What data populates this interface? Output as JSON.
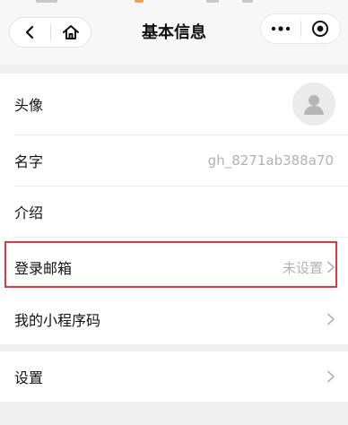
{
  "header": {
    "title": "基本信息",
    "back_icon": "chevron-left-icon",
    "home_icon": "home-icon",
    "more_icon": "more-dots-icon",
    "close_icon": "target-circle-icon"
  },
  "rows": {
    "avatar": {
      "label": "头像"
    },
    "name": {
      "label": "名字",
      "value": "gh_8271ab388a70"
    },
    "intro": {
      "label": "介绍"
    },
    "email": {
      "label": "登录邮箱",
      "value": "未设置"
    },
    "qrcode": {
      "label": "我的小程序码"
    },
    "settings": {
      "label": "设置"
    }
  },
  "colors": {
    "highlight_border": "#e0393c",
    "page_background": "#f0f0f0",
    "value_text": "#b2b2b2"
  }
}
